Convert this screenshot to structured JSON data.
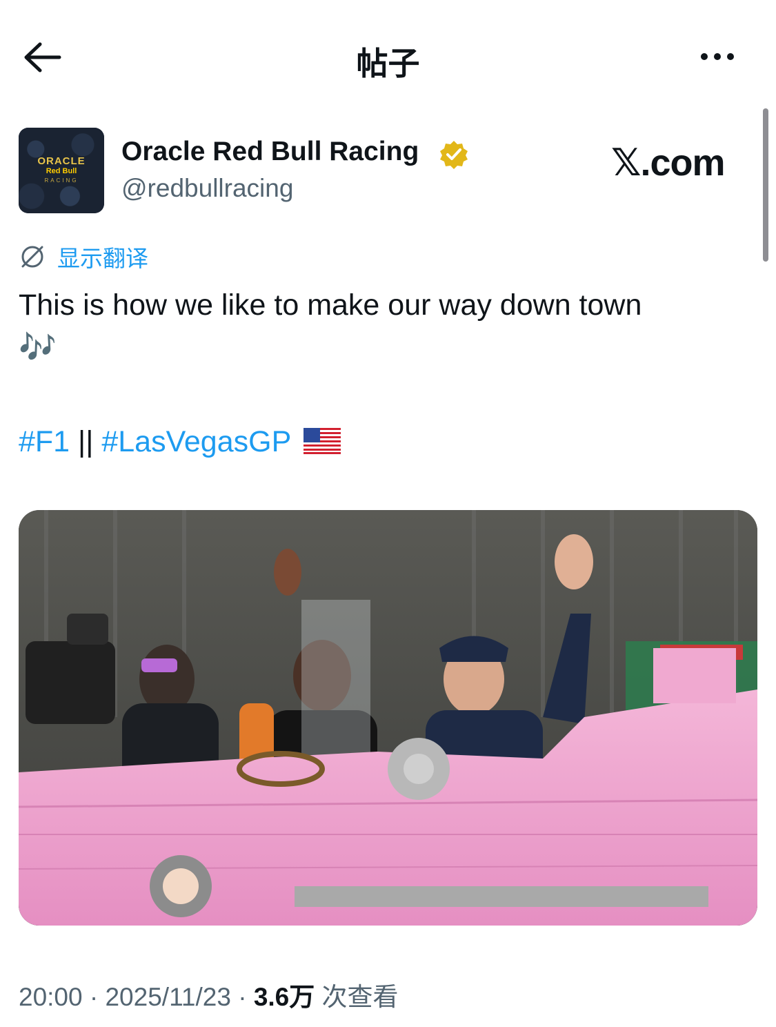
{
  "header": {
    "title": "帖子",
    "back_icon": "arrow-left-icon",
    "more_icon": "more-horizontal-icon"
  },
  "post": {
    "author": {
      "name": "Oracle Red Bull Racing",
      "handle": "@redbullracing",
      "verified_badge": "gold-verified-badge-icon",
      "avatar_text": {
        "line1": "ORACLE",
        "line2": "Red Bull",
        "line3": "RACING"
      }
    },
    "watermark": "𝕏.com",
    "translate_label": "显示翻译",
    "text": "This is how we like to make our way down town",
    "notes_emoji": "🎶",
    "hashtags": {
      "tag1": "#F1",
      "separator": " || ",
      "tag2": "#LasVegasGP"
    },
    "flag_icon": "us-flag-icon",
    "meta": {
      "time": "20:00",
      "date": "2025/11/23",
      "views_count": "3.6万",
      "views_label": "次查看",
      "dot": "·"
    }
  },
  "colors": {
    "accent": "#1d9bf0",
    "text": "#0f1419",
    "secondary": "#536471",
    "verified_gold": "#e2b719"
  }
}
